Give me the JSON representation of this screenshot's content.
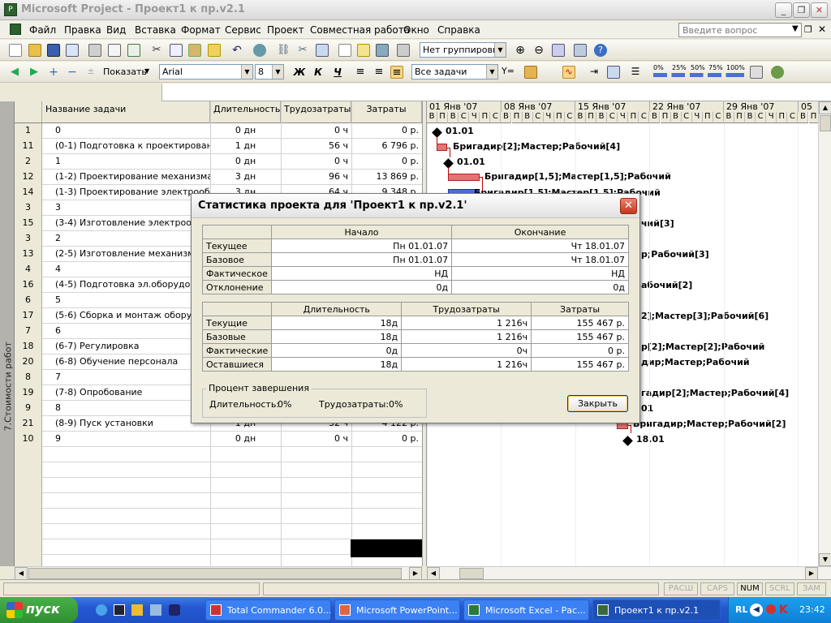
{
  "window": {
    "title": "Microsoft Project - Проект1 к пр.v2.1"
  },
  "menu": [
    "Файл",
    "Правка",
    "Вид",
    "Вставка",
    "Формат",
    "Сервис",
    "Проект",
    "Совместная работа",
    "Окно",
    "Справка"
  ],
  "help_placeholder": "Введите вопрос",
  "toolbar": {
    "grouping": "Нет группировки",
    "show_label": "Показать",
    "font": "Arial",
    "font_size": "8",
    "bold": "Ж",
    "italic": "К",
    "underline": "Ч",
    "filter": "Все задачи",
    "pct": [
      "0%",
      "25%",
      "50%",
      "75%",
      "100%"
    ]
  },
  "left_bar_label": "7.Стоимости работ",
  "grid": {
    "headers": [
      "Название задачи",
      "Длительность",
      "Трудозатраты",
      "Затраты"
    ],
    "rows": [
      {
        "id": "1",
        "name": "0",
        "dur": "0 дн",
        "work": "0 ч",
        "cost": "0 р."
      },
      {
        "id": "11",
        "name": "(0-1) Подготовка к проектированию",
        "dur": "1 дн",
        "work": "56 ч",
        "cost": "6 796 р."
      },
      {
        "id": "2",
        "name": "1",
        "dur": "0 дн",
        "work": "0 ч",
        "cost": "0 р."
      },
      {
        "id": "12",
        "name": "(1-2) Проектирование механизма",
        "dur": "3 дн",
        "work": "96 ч",
        "cost": "13 869 р."
      },
      {
        "id": "14",
        "name": "(1-3) Проектирование электрообо",
        "dur": "3 дн",
        "work": "64 ч",
        "cost": "9 348 р."
      },
      {
        "id": "3",
        "name": "3",
        "dur": "",
        "work": "",
        "cost": ""
      },
      {
        "id": "15",
        "name": "(3-4) Изготовление электрообор",
        "dur": "",
        "work": "",
        "cost": ""
      },
      {
        "id": "3",
        "name": "2",
        "dur": "",
        "work": "",
        "cost": ""
      },
      {
        "id": "13",
        "name": "(2-5) Изготовление механизма",
        "dur": "",
        "work": "",
        "cost": ""
      },
      {
        "id": "4",
        "name": "4",
        "dur": "",
        "work": "",
        "cost": ""
      },
      {
        "id": "16",
        "name": "(4-5) Подготовка эл.оборудован",
        "dur": "",
        "work": "",
        "cost": ""
      },
      {
        "id": "6",
        "name": "5",
        "dur": "",
        "work": "",
        "cost": ""
      },
      {
        "id": "17",
        "name": "(5-6) Сборка и монтаж оборудов",
        "dur": "",
        "work": "",
        "cost": ""
      },
      {
        "id": "7",
        "name": "6",
        "dur": "",
        "work": "",
        "cost": ""
      },
      {
        "id": "18",
        "name": "(6-7) Регулировка",
        "dur": "",
        "work": "",
        "cost": ""
      },
      {
        "id": "20",
        "name": "(6-8) Обучение персонала",
        "dur": "",
        "work": "",
        "cost": ""
      },
      {
        "id": "8",
        "name": "7",
        "dur": "",
        "work": "",
        "cost": ""
      },
      {
        "id": "19",
        "name": "(7-8) Опробование",
        "dur": "",
        "work": "",
        "cost": ""
      },
      {
        "id": "9",
        "name": "8",
        "dur": "",
        "work": "",
        "cost": ""
      },
      {
        "id": "21",
        "name": "(8-9) Пуск установки",
        "dur": "1 дн",
        "work": "32 ч",
        "cost": "4 122 р."
      },
      {
        "id": "10",
        "name": "9",
        "dur": "0 дн",
        "work": "0 ч",
        "cost": "0 р."
      }
    ]
  },
  "gantt": {
    "weeks": [
      "01 Янв '07",
      "08 Янв '07",
      "15 Янв '07",
      "22 Янв '07",
      "29 Янв '07",
      "05"
    ],
    "day_letters": [
      "В",
      "П",
      "В",
      "С",
      "Ч",
      "П",
      "С"
    ],
    "labels": {
      "ms1": "01.01",
      "r11": "Бригадир[2];Мастер;Рабочий[4]",
      "ms2": "01.01",
      "r12": "Бригадир[1,5];Мастер[1,5];Рабочий",
      "r14": "Бригадир[1,5];Мастер[1,5];Рабочий",
      "r15": "чий[3]",
      "r13": "р;Рабочий[3]",
      "r16": "абочий[2]",
      "r17": "2];Мастер[3];Рабочий[6]",
      "r18": "р[2];Мастер[2];Рабочий",
      "r20": "дир;Мастер;Рабочий",
      "r19": "гадир[2];Мастер;Рабочий[4]",
      "ms9": "01",
      "r21": "Бригадир;Мастер;Рабочий[2]",
      "ms10": "18.01"
    }
  },
  "dialog": {
    "title": "Статистика проекта для 'Проект1 к пр.v2.1'",
    "dates": {
      "headers": [
        "Начало",
        "Окончание"
      ],
      "rows": [
        {
          "label": "Текущее",
          "start": "Пн 01.01.07",
          "finish": "Чт 18.01.07"
        },
        {
          "label": "Базовое",
          "start": "Пн 01.01.07",
          "finish": "Чт 18.01.07"
        },
        {
          "label": "Фактическое",
          "start": "НД",
          "finish": "НД"
        },
        {
          "label": "Отклонение",
          "start": "0д",
          "finish": "0д"
        }
      ]
    },
    "totals": {
      "headers": [
        "Длительность",
        "Трудозатраты",
        "Затраты"
      ],
      "rows": [
        {
          "label": "Текущие",
          "dur": "18д",
          "work": "1 216ч",
          "cost": "155 467 р."
        },
        {
          "label": "Базовые",
          "dur": "18д",
          "work": "1 216ч",
          "cost": "155 467 р."
        },
        {
          "label": "Фактические",
          "dur": "0д",
          "work": "0ч",
          "cost": "0 р."
        },
        {
          "label": "Оставшиеся",
          "dur": "18д",
          "work": "1 216ч",
          "cost": "155 467 р."
        }
      ]
    },
    "percent": {
      "legend": "Процент завершения",
      "dur_label": "Длительность:",
      "dur_value": "0%",
      "work_label": "Трудозатраты:",
      "work_value": "0%"
    },
    "close_label": "Закрыть"
  },
  "status": [
    "РАСШ",
    "CAPS",
    "NUM",
    "SCRL",
    "ЗАМ"
  ],
  "taskbar": {
    "start": "пуск",
    "buttons": [
      "Total Commander 6.0...",
      "Microsoft PowerPoint...",
      "Microsoft Excel - Рас...",
      "Проект1 к пр.v2.1"
    ],
    "lang": "RL",
    "clock": "23:42"
  }
}
